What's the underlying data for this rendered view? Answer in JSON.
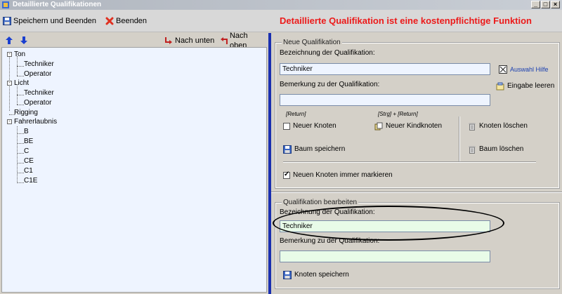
{
  "window": {
    "title": "Detaillierte Qualifikationen",
    "minimize": "_",
    "maximize": "□",
    "close": "×"
  },
  "toolbar": {
    "save_and_exit": "Speichern und Beenden",
    "exit": "Beenden",
    "paywall_notice": "Detaillierte Qualifikation ist eine kostenpflichtige Funktion"
  },
  "tree_toolbar": {
    "move_down": "Nach unten",
    "move_up": "Nach oben"
  },
  "tree": {
    "nodes": [
      {
        "label": "Ton"
      },
      {
        "label": "Techniker"
      },
      {
        "label": "Operator"
      },
      {
        "label": "Licht"
      },
      {
        "label": "Techniker"
      },
      {
        "label": "Operator"
      },
      {
        "label": "Rigging"
      },
      {
        "label": "Fahrerlaubnis"
      },
      {
        "label": "B"
      },
      {
        "label": "BE"
      },
      {
        "label": "C"
      },
      {
        "label": "CE"
      },
      {
        "label": "C1"
      },
      {
        "label": "C1E"
      }
    ]
  },
  "new_qualification": {
    "legend": "Neue Qualifikation",
    "name_label": "Bezeichnung der Qualifikation:",
    "name_value": "Techniker",
    "help_link": "Auswahl Hilfe",
    "remark_label": "Bemerkung zu der Qualifikation:",
    "remark_value": "",
    "clear_input": "Eingabe leeren",
    "hint_return": "[Return]",
    "hint_ctrl_return": "[Strg] + [Return]",
    "new_node": "Neuer Knoten",
    "new_child_node": "Neuer Kindknoten",
    "delete_node": "Knoten löschen",
    "save_tree": "Baum speichern",
    "delete_tree": "Baum löschen",
    "always_mark": "Neuen Knoten immer markieren"
  },
  "edit_qualification": {
    "legend": "Qualifikation bearbeiten",
    "name_label": "Bezeichnung der Qualifikation:",
    "name_value": "Techniker",
    "remark_label": "Bemerkung zu der Qualifikation:",
    "remark_value": "",
    "save_node": "Knoten speichern"
  },
  "colors": {
    "paywall": "#ec1a1a",
    "tree_bg": "#eef4ff",
    "divider": "#1a2fb0",
    "input_new": "#eef4ff",
    "input_edit": "#e8fbe8"
  }
}
